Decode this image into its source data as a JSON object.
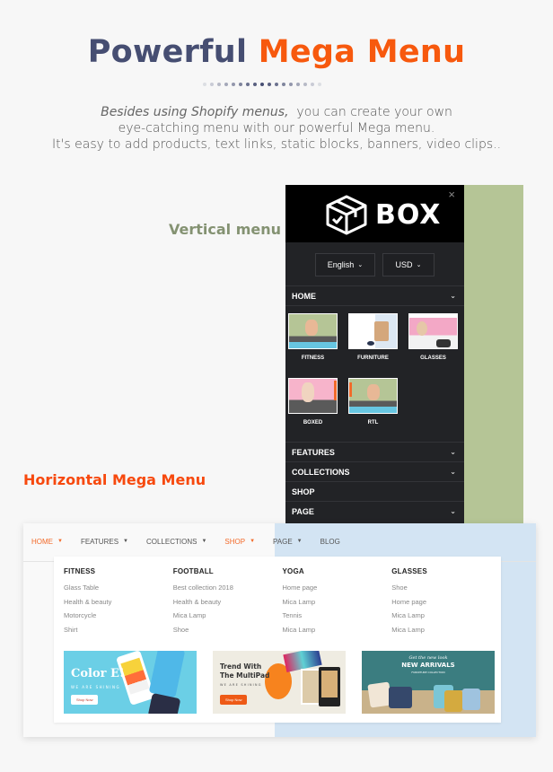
{
  "header": {
    "title_part1": "Powerful",
    "title_part2": "Mega Menu",
    "title_color1": "#464e72",
    "title_color2": "#f7590e",
    "desc_line1_italic": "Besides using Shopify menus,",
    "desc_line1_rest": "you can create your own",
    "desc_line2": "eye-catching menu with our powerful Mega menu.",
    "desc_line3": "It's easy to add products, text links, static blocks, banners, video clips.."
  },
  "labels": {
    "vertical": "Vertical menu",
    "horizontal": "Horizontal Mega Menu"
  },
  "vertical_menu": {
    "logo_text": "BOX",
    "close": "×",
    "language": "English",
    "currency": "USD",
    "home_label": "HOME",
    "home_thumbs": [
      {
        "label": "FITNESS"
      },
      {
        "label": "FURNITURE"
      },
      {
        "label": "GLASSES"
      },
      {
        "label": "BOXED"
      },
      {
        "label": "RTL"
      }
    ],
    "items": [
      {
        "label": "FEATURES",
        "chevron": "⌄"
      },
      {
        "label": "COLLECTIONS",
        "chevron": "⌄"
      },
      {
        "label": "SHOP",
        "chevron": ""
      },
      {
        "label": "PAGE",
        "chevron": "⌄"
      }
    ]
  },
  "horizontal_menu": {
    "nav": [
      {
        "label": "HOME",
        "caret": "▼",
        "active": true
      },
      {
        "label": "FEATURES",
        "caret": "▼",
        "active": false
      },
      {
        "label": "COLLECTIONS",
        "caret": "▼",
        "active": false
      },
      {
        "label": "SHOP",
        "caret": "▼",
        "active": true
      },
      {
        "label": "PAGE",
        "caret": "▼",
        "active": false
      },
      {
        "label": "BLOG",
        "caret": "",
        "active": false
      }
    ],
    "columns": [
      {
        "title": "FITNESS",
        "links": [
          "Glass Table",
          "Health & beauty",
          "Motorcycle",
          "Shirt"
        ]
      },
      {
        "title": "FOOTBALL",
        "links": [
          "Best collection 2018",
          "Health & beauty",
          "Mica Lamp",
          "Shoe"
        ]
      },
      {
        "title": "YOGA",
        "links": [
          "Home page",
          "Mica Lamp",
          "Tennis",
          "Mica Lamp"
        ]
      },
      {
        "title": "GLASSES",
        "links": [
          "Shoe",
          "Home page",
          "Mica Lamp",
          "Mica Lamp"
        ]
      }
    ],
    "banners": [
      {
        "title": "Color E!",
        "subtitle": "WE ARE SHINING",
        "button": "Shop Now"
      },
      {
        "title_line1": "Trend With",
        "title_line2": "The MultiPad",
        "subtitle": "WE ARE SHINING",
        "button": "Shop Now"
      },
      {
        "script": "Get the new look",
        "title": "NEW ARRIVALS",
        "subtitle": "FURNITURE COLLECTION"
      }
    ]
  },
  "colors": {
    "accent_orange": "#f36a2a",
    "vertical_label": "#849272",
    "horizontal_label": "#f7490e",
    "menu_dark": "#222326",
    "panel_green": "#b5c596",
    "panel_blue": "#d3e4f3"
  }
}
